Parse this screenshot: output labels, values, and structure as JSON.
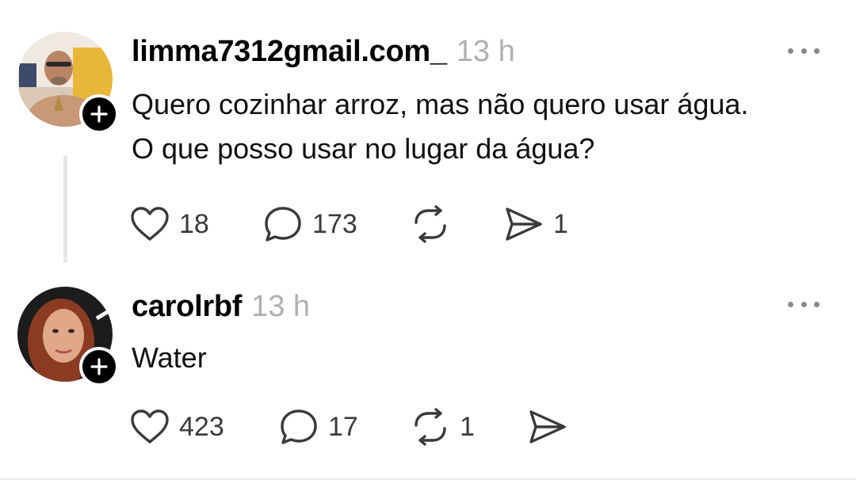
{
  "posts": [
    {
      "username": "limma7312gmail.com_",
      "time": "13 h",
      "text_lines": [
        "Quero cozinhar arroz, mas não quero usar água.",
        "O que posso usar no lugar da água?"
      ],
      "likes": "18",
      "comments": "173",
      "reposts": "",
      "shares": "1"
    },
    {
      "username": "carolrbf",
      "time": "13 h",
      "text_lines": [
        "Water"
      ],
      "likes": "423",
      "comments": "17",
      "reposts": "1",
      "shares": ""
    }
  ],
  "icons": {
    "like": "heart-icon",
    "comment": "speech-bubble-icon",
    "repost": "repost-arrows-icon",
    "share": "paper-plane-icon",
    "more": "more-horizontal-icon",
    "follow": "plus-icon"
  },
  "colors": {
    "text": "#101010",
    "muted": "#b0b0b0",
    "icon": "#3a3a3a",
    "badge": "#000000"
  }
}
